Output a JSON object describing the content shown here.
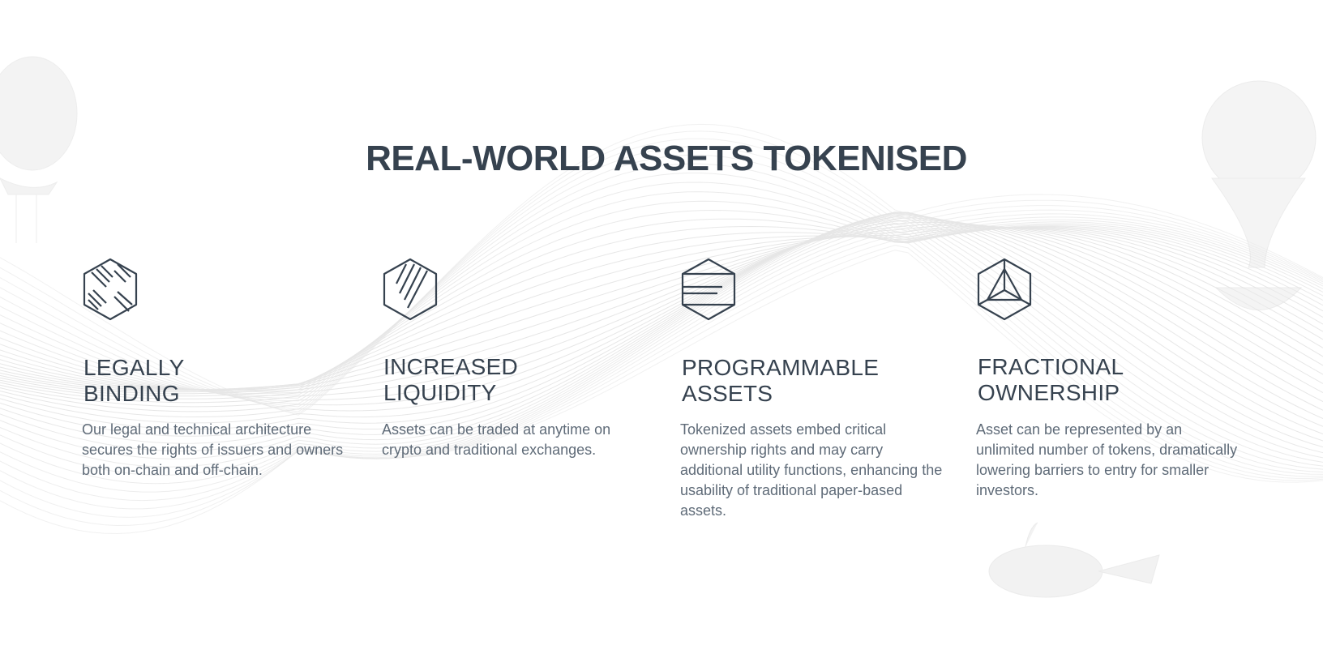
{
  "title": "REAL-WORLD ASSETS TOKENISED",
  "colors": {
    "heading": "#36424f",
    "body_text": "#5f6b78",
    "icon_stroke": "#36424f",
    "background_lines": "#e8e8e8"
  },
  "features": [
    {
      "icon": "hexagon-diagonal-weave-icon",
      "heading_line1": "LEGALLY",
      "heading_line2": "BINDING",
      "description": "Our legal and technical architecture secures the rights of issuers and owners both on-chain and off-chain."
    },
    {
      "icon": "hexagon-diagonal-lines-icon",
      "heading_line1": "INCREASED",
      "heading_line2": "LIQUIDITY",
      "description": "Assets can be traded at anytime on crypto and traditional exchanges."
    },
    {
      "icon": "hexagon-horizontal-lines-icon",
      "heading_line1": "PROGRAMMABLE",
      "heading_line2": "ASSETS",
      "description": "Tokenized assets embed critical ownership rights and may carry additional utility functions, enhancing the usability of traditional paper-based assets."
    },
    {
      "icon": "hexagon-triangle-cube-icon",
      "heading_line1": "FRACTIONAL",
      "heading_line2": "OWNERSHIP",
      "description": "Asset can be represented by an unlimited number of tokens, dramatically lowering barriers to entry for smaller investors."
    }
  ]
}
